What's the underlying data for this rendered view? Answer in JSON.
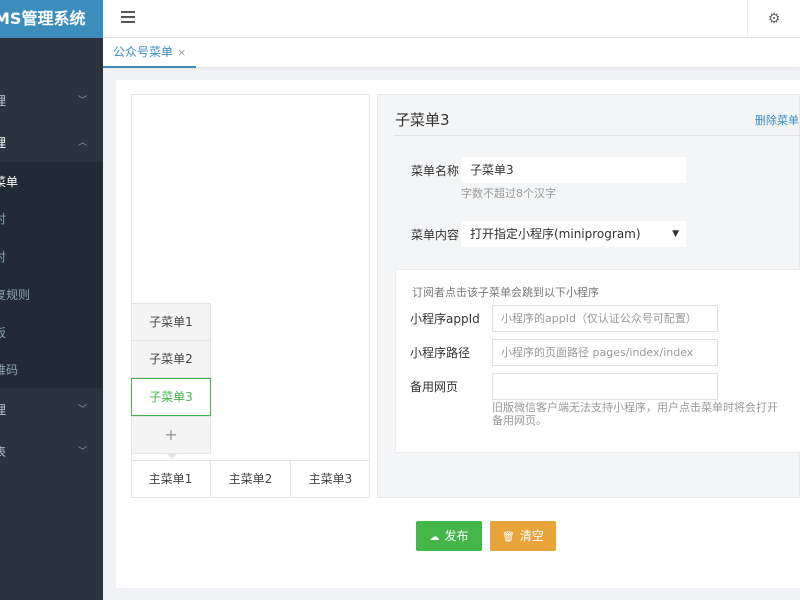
{
  "app": {
    "title": "MS管理系统"
  },
  "sidebar": {
    "items": [
      {
        "label": "理"
      },
      {
        "label": "理"
      },
      {
        "label": "理"
      },
      {
        "label": "表"
      }
    ],
    "subitems": [
      {
        "label": "菜单"
      },
      {
        "label": "对"
      },
      {
        "label": "对"
      },
      {
        "label": "复规则"
      },
      {
        "label": "板"
      },
      {
        "label": "维码"
      }
    ]
  },
  "tabs": [
    {
      "label": "公众号菜单",
      "close": "×"
    }
  ],
  "preview": {
    "submenus": [
      "子菜单1",
      "子菜单2",
      "子菜单3"
    ],
    "add_label": "+",
    "mainmenus": [
      "主菜单1",
      "主菜单2",
      "主菜单3"
    ]
  },
  "editor": {
    "title": "子菜单3",
    "delete_label": "删除菜单",
    "name_label": "菜单名称",
    "name_value": "子菜单3",
    "name_hint": "字数不超过8个汉字",
    "content_label": "菜单内容",
    "content_value": "打开指定小程序(miniprogram)",
    "mp": {
      "intro": "订阅者点击该子菜单会跳到以下小程序",
      "appid_label": "小程序appId",
      "appid_placeholder": "小程序的appId（仅认证公众号可配置）",
      "path_label": "小程序路径",
      "path_placeholder": "小程序的页面路径 pages/index/index",
      "url_label": "备用网页",
      "url_placeholder": "",
      "url_hint": "旧版微信客户端无法支持小程序，用户点击菜单时将会打开备用网页。"
    }
  },
  "actions": {
    "publish": "发布",
    "clear": "清空"
  },
  "colors": {
    "primary": "#3c8dbc",
    "green": "#44b549",
    "orange": "#e8a33b",
    "sidebar": "#2b333e"
  }
}
